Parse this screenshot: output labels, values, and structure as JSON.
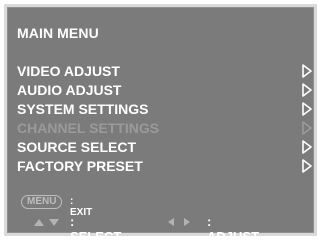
{
  "menu": {
    "title": "MAIN MENU",
    "items": [
      {
        "label": "VIDEO ADJUST",
        "enabled": true,
        "icon": "chevron-right-icon"
      },
      {
        "label": "AUDIO ADJUST",
        "enabled": true,
        "icon": "chevron-right-icon"
      },
      {
        "label": "SYSTEM SETTINGS",
        "enabled": true,
        "icon": "chevron-right-icon"
      },
      {
        "label": "CHANNEL SETTINGS",
        "enabled": false,
        "icon": "chevron-right-icon"
      },
      {
        "label": "SOURCE SELECT",
        "enabled": true,
        "icon": "chevron-right-icon"
      },
      {
        "label": "FACTORY PRESET",
        "enabled": true,
        "icon": "chevron-right-icon"
      }
    ]
  },
  "hints": {
    "menu_key": "MENU",
    "exit_label": ": EXIT",
    "select_label": ": SELECT",
    "adjust_label": ": ADJUST",
    "select_icon": "up-down-arrows-icon",
    "adjust_icon": "left-right-arrows-icon"
  },
  "colors": {
    "background": "#7b7b7b",
    "border": "#d9d9d9",
    "text": "#ffffff",
    "disabled_text": "#9a9a9a"
  }
}
